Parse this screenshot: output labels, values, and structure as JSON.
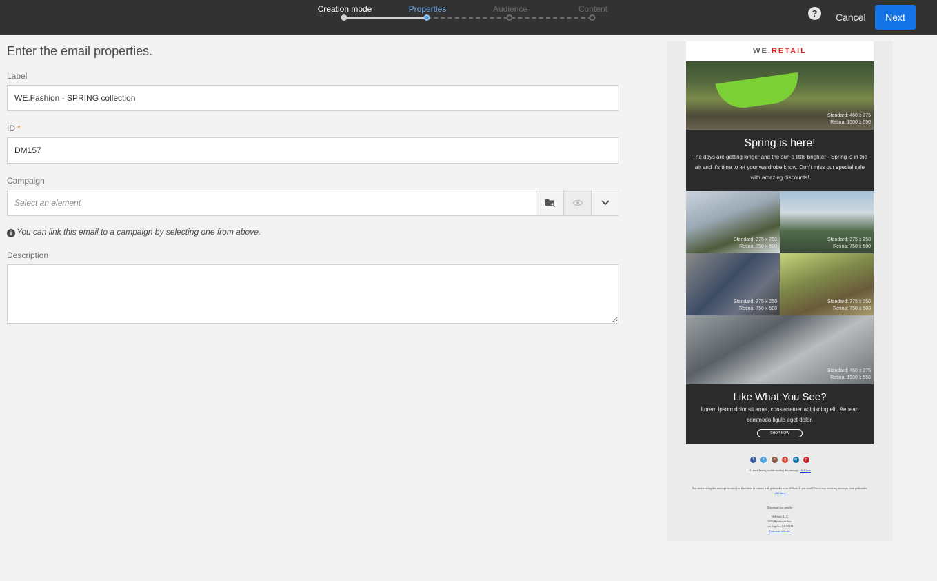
{
  "header": {
    "steps": [
      {
        "label": "Creation mode",
        "state": "done"
      },
      {
        "label": "Properties",
        "state": "active"
      },
      {
        "label": "Audience",
        "state": "todo"
      },
      {
        "label": "Content",
        "state": "todo"
      }
    ],
    "help_icon": "?",
    "cancel_label": "Cancel",
    "next_label": "Next"
  },
  "form": {
    "title": "Enter the email properties.",
    "label_field": {
      "label": "Label",
      "value": "WE.Fashion - SPRING collection"
    },
    "id_field": {
      "label": "ID",
      "required_mark": "*",
      "value": "DM157"
    },
    "campaign_field": {
      "label": "Campaign",
      "placeholder": "Select an element"
    },
    "hint": "You can link this email to a campaign by selecting one from above.",
    "description_field": {
      "label": "Description",
      "value": ""
    }
  },
  "preview": {
    "brand_we": "WE.",
    "brand_retail": "RETAIL",
    "hero_caption_1": "Standard: 460 x 275",
    "hero_caption_2": "Retina: 1500 x 550",
    "spring_title": "Spring is here!",
    "spring_body": "The days are getting longer and the sun a little brighter - Spring is in the air and it's time to let your wardrobe know. Don't miss our special sale with amazing discounts!",
    "tile_caption_1": "Standard: 375 x 250",
    "tile_caption_2": "Retina: 750 x 500",
    "rocks_caption_1": "Standard: 460 x 275",
    "rocks_caption_2": "Retina: 1500 x 550",
    "like_title": "Like What You See?",
    "like_body": "Lorem ipsum dolor sit amet, consectetuer adipiscing elit. Aenean commodo ligula eget dolor.",
    "shop_label": "SHOP NOW",
    "social_icons": [
      "facebook-icon",
      "twitter-icon",
      "instagram-icon",
      "google-plus-icon",
      "linkedin-icon",
      "pinterest-icon"
    ],
    "footer_trouble": "If you're having trouble reading this message,",
    "footer_trouble_link": "click here",
    "footer_receiving": "You are receiving this message because you have been in contact with geekstudio or an affiliate. If you would like to stop receiving messages from geekstudio,",
    "footer_receiving_link": "click here.",
    "footer_sent_by": "This email was sent by:",
    "footer_company": "WeRetail, LLC",
    "footer_street": "6070 Hawthorne Ave.",
    "footer_city": "Los Angeles, CA 90210",
    "footer_website": "Customer web site"
  },
  "colors": {
    "topbar": "#323232",
    "accent_blue": "#1473e6",
    "active_step": "#6aa6e6",
    "required": "#e68619"
  }
}
